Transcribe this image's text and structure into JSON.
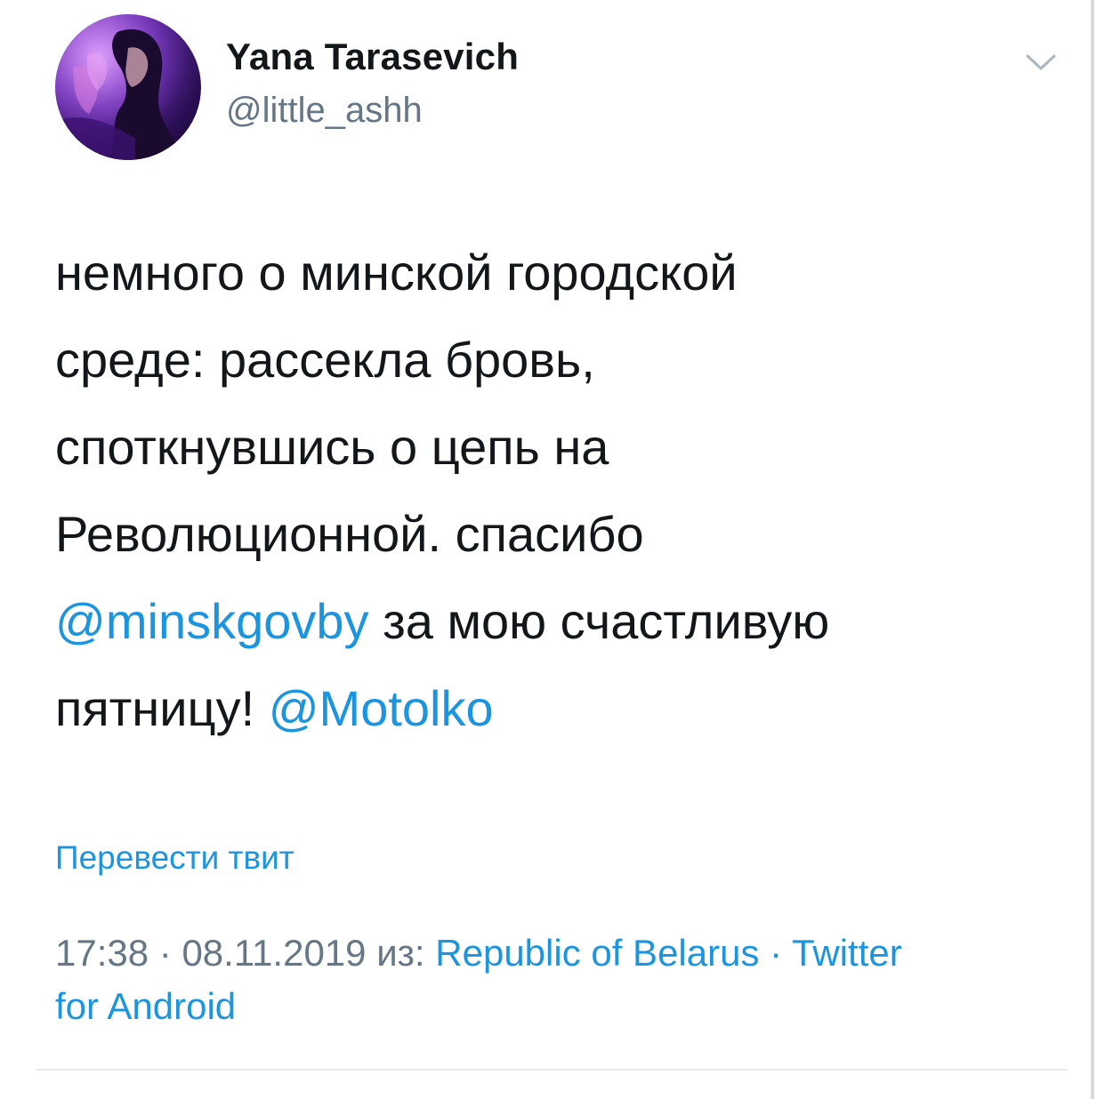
{
  "tweet": {
    "author_name": "Yana Tarasevich",
    "author_handle": "@little_ashh",
    "avatar_icon": "avatar-photo",
    "menu_icon": "chevron-down-icon",
    "text": {
      "line1": "немного о минской городской",
      "line2": "среде: рассекла бровь,",
      "line3": "споткнувшись о цепь на",
      "line4": "Революционной. спасибо",
      "mention1": "@minskgovby",
      "line5_rest": " за мою счастливую",
      "line6_start": "пятницу! ",
      "mention2": "@Motolko"
    },
    "translate_label": "Перевести твит",
    "meta": {
      "time": "17:38",
      "sep1": " · ",
      "date": "08.11.2019",
      "from_label": " из: ",
      "location": "Republic of Belarus",
      "sep2": " · ",
      "source_part1": "Twitter",
      "source_part2": "for Android"
    }
  },
  "colors": {
    "text": "#14171a",
    "secondary": "#657786",
    "link": "#1b95e0",
    "divider": "#e6ecf0"
  }
}
